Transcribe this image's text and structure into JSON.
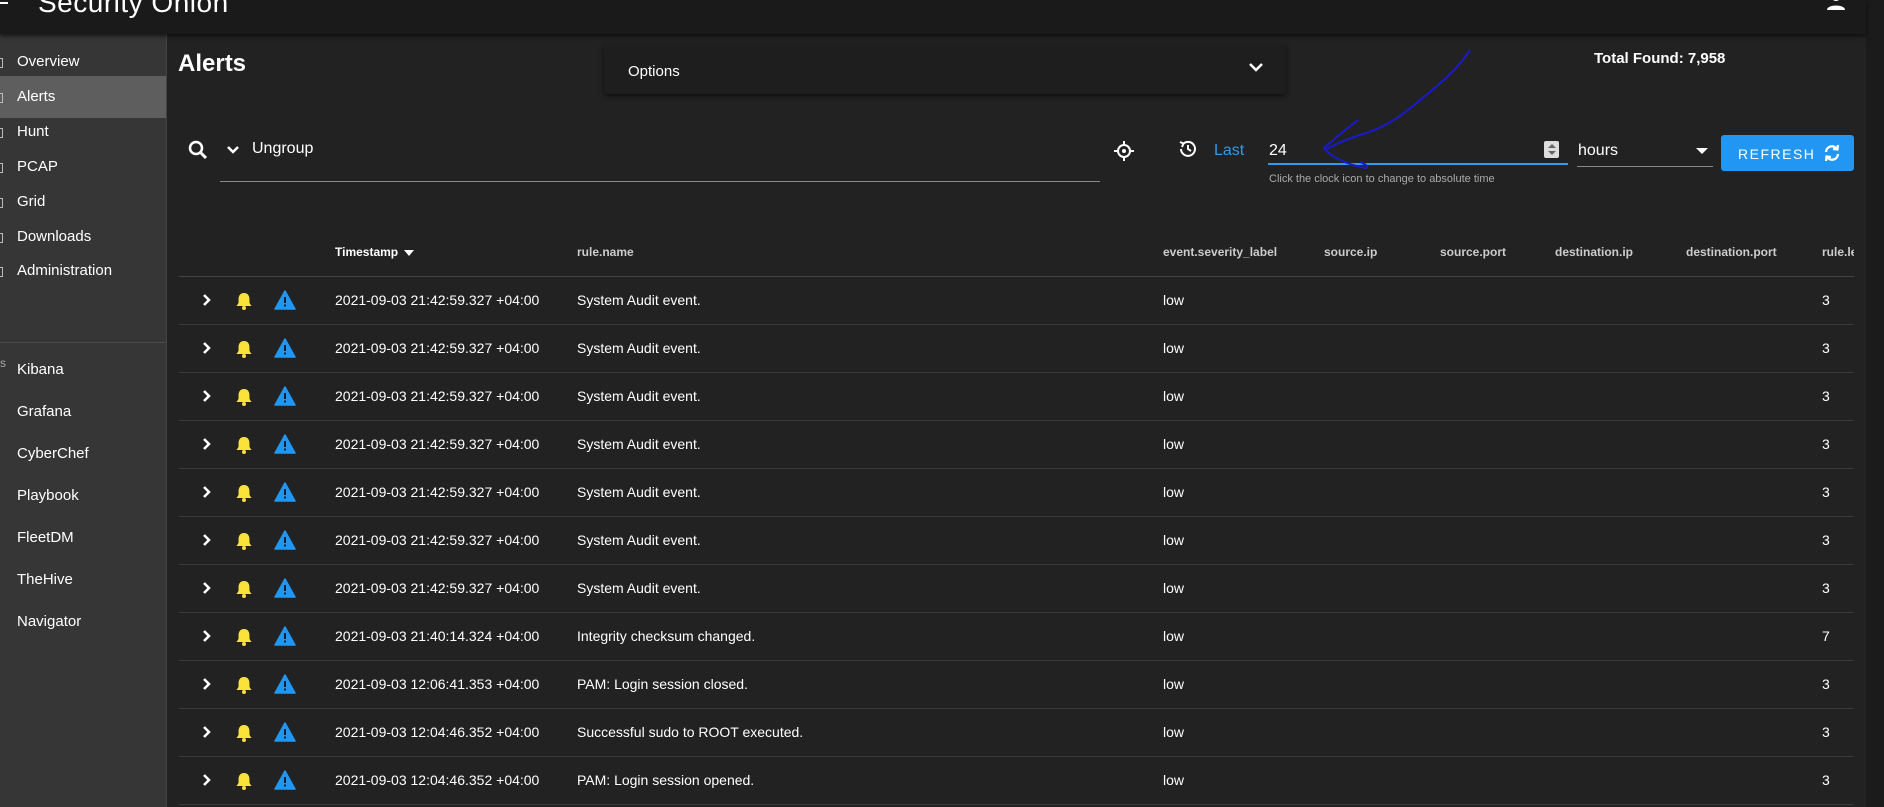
{
  "app": {
    "brand": "Security Onion",
    "colors": {
      "accent": "#2196f3",
      "bell": "#f9e23b",
      "warning": "#2196f3",
      "annotation": "#1a1acc"
    }
  },
  "sidebar": {
    "items": [
      {
        "label": "Overview",
        "icon": "overview-icon"
      },
      {
        "label": "Alerts",
        "icon": "alert-icon",
        "active": true
      },
      {
        "label": "Hunt",
        "icon": "hunt-icon"
      },
      {
        "label": "PCAP",
        "icon": "pcap-icon"
      },
      {
        "label": "Grid",
        "icon": "grid-icon"
      },
      {
        "label": "Downloads",
        "icon": "download-icon"
      },
      {
        "label": "Administration",
        "icon": "admin-icon"
      }
    ],
    "section_label": "s",
    "tools": [
      {
        "label": "Kibana"
      },
      {
        "label": "Grafana"
      },
      {
        "label": "CyberChef"
      },
      {
        "label": "Playbook"
      },
      {
        "label": "FleetDM"
      },
      {
        "label": "TheHive"
      },
      {
        "label": "Navigator"
      }
    ]
  },
  "page": {
    "title": "Alerts",
    "options_label": "Options",
    "total_found": "Total Found: 7,958"
  },
  "query": {
    "text": "Ungroup"
  },
  "time_range": {
    "last_label": "Last",
    "value": "24",
    "unit": "hours",
    "hint": "Click the clock icon to change to absolute time",
    "refresh_label": "REFRESH"
  },
  "table": {
    "columns": [
      "Timestamp",
      "rule.name",
      "event.severity_label",
      "source.ip",
      "source.port",
      "destination.ip",
      "destination.port",
      "rule.le"
    ],
    "rows": [
      {
        "timestamp": "2021-09-03 21:42:59.327 +04:00",
        "rule": "System Audit event.",
        "severity": "low",
        "level": "3"
      },
      {
        "timestamp": "2021-09-03 21:42:59.327 +04:00",
        "rule": "System Audit event.",
        "severity": "low",
        "level": "3"
      },
      {
        "timestamp": "2021-09-03 21:42:59.327 +04:00",
        "rule": "System Audit event.",
        "severity": "low",
        "level": "3"
      },
      {
        "timestamp": "2021-09-03 21:42:59.327 +04:00",
        "rule": "System Audit event.",
        "severity": "low",
        "level": "3"
      },
      {
        "timestamp": "2021-09-03 21:42:59.327 +04:00",
        "rule": "System Audit event.",
        "severity": "low",
        "level": "3"
      },
      {
        "timestamp": "2021-09-03 21:42:59.327 +04:00",
        "rule": "System Audit event.",
        "severity": "low",
        "level": "3"
      },
      {
        "timestamp": "2021-09-03 21:42:59.327 +04:00",
        "rule": "System Audit event.",
        "severity": "low",
        "level": "3"
      },
      {
        "timestamp": "2021-09-03 21:40:14.324 +04:00",
        "rule": "Integrity checksum changed.",
        "severity": "low",
        "level": "7"
      },
      {
        "timestamp": "2021-09-03 12:06:41.353 +04:00",
        "rule": "PAM: Login session closed.",
        "severity": "low",
        "level": "3"
      },
      {
        "timestamp": "2021-09-03 12:04:46.352 +04:00",
        "rule": "Successful sudo to ROOT executed.",
        "severity": "low",
        "level": "3"
      },
      {
        "timestamp": "2021-09-03 12:04:46.352 +04:00",
        "rule": "PAM: Login session opened.",
        "severity": "low",
        "level": "3"
      }
    ]
  }
}
